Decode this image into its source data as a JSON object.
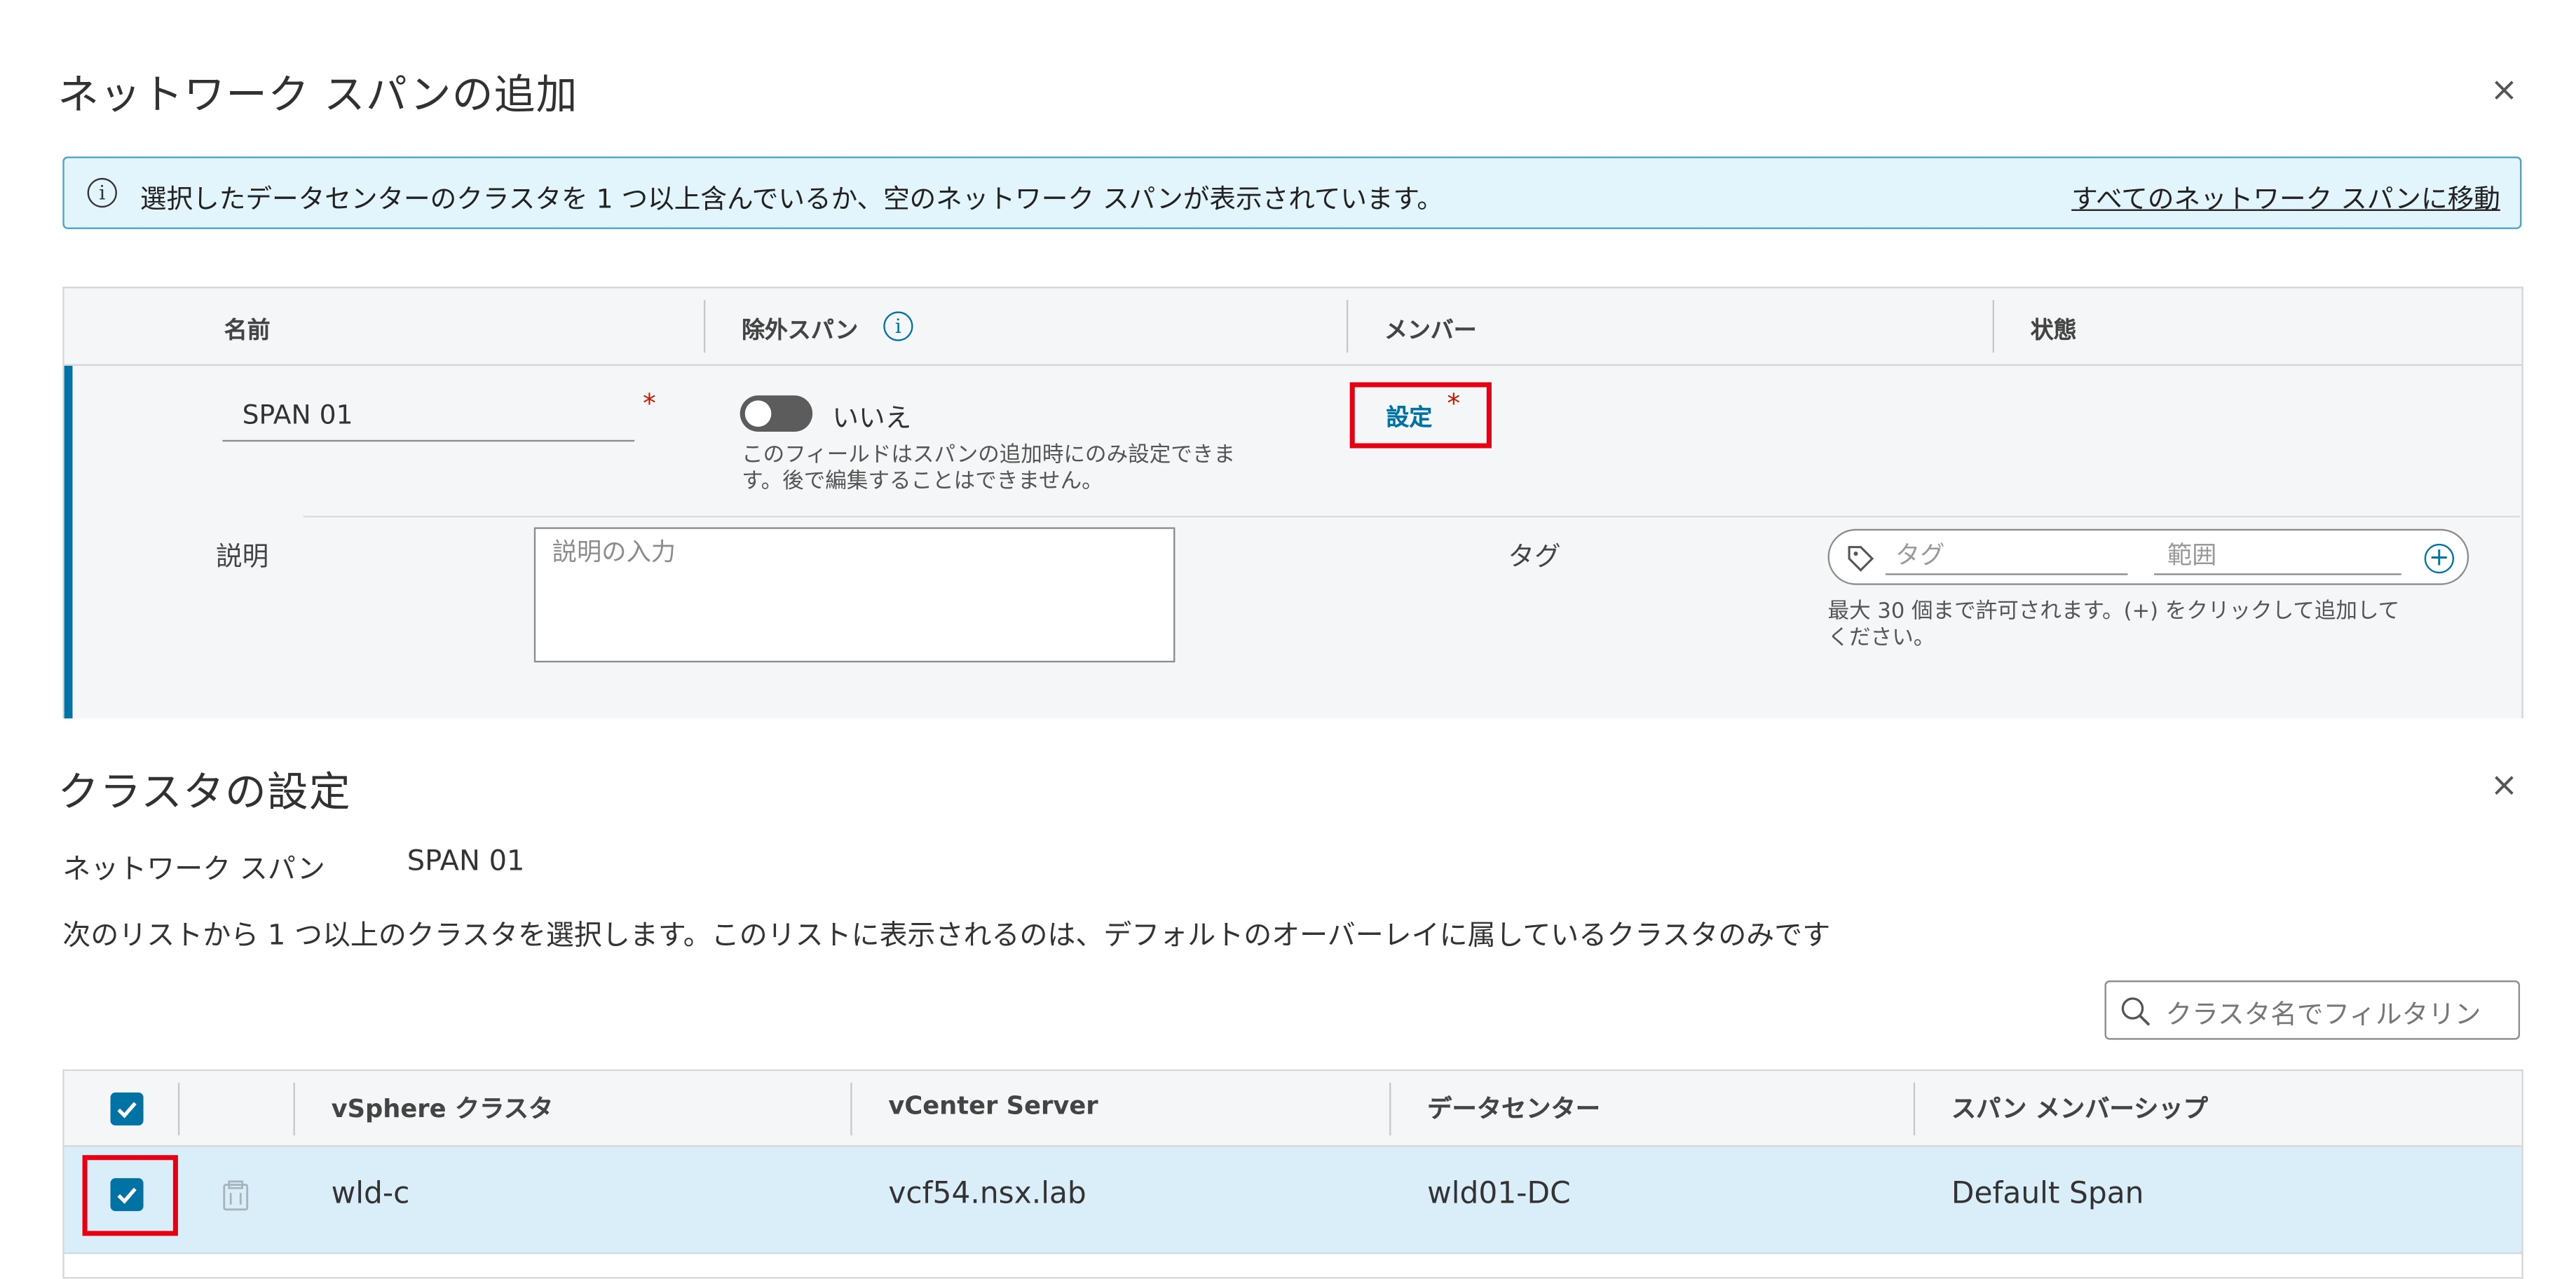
{
  "dialog": {
    "title": "ネットワーク スパンの追加",
    "close": "×"
  },
  "banner": {
    "icon": "info-icon",
    "text": "選択したデータセンターのクラスタを 1 つ以上含んでいるか、空のネットワーク スパンが表示されています。",
    "link": "すべてのネットワーク スパンに移動"
  },
  "span_grid": {
    "headers": {
      "name": "名前",
      "excluded": "除外スパン",
      "members": "メンバー",
      "status": "状態"
    },
    "row": {
      "name_value": "SPAN 01",
      "required": "*",
      "toggle_label": "いいえ",
      "toggle_on": false,
      "help": [
        "このフィールドはスパンの追加時にのみ設定できま",
        "す。後で編集することはできません。"
      ],
      "members_link": "設定",
      "description_label": "説明",
      "description_placeholder": "説明の入力",
      "tag_label": "タグ",
      "tag_placeholder": "タグ",
      "scope_placeholder": "範囲",
      "tag_help": [
        "最大 30 個まで許可されます。(+) をクリックして追加して",
        "ください。"
      ]
    }
  },
  "cluster_dialog": {
    "title": "クラスタの設定",
    "close": "×",
    "span_label": "ネットワーク スパン",
    "span_value": "SPAN 01",
    "instruction": "次のリストから 1 つ以上のクラスタを選択します。このリストに表示されるのは、デフォルトのオーバーレイに属しているクラスタのみです",
    "filter_placeholder": "クラスタ名でフィルタリン",
    "table": {
      "headers": [
        "vSphere クラスタ",
        "vCenter Server",
        "データセンター",
        "スパン メンバーシップ"
      ],
      "rows": [
        {
          "cluster": "wld-c",
          "vcenter": "vcf54.nsx.lab",
          "datacenter": "wld01-DC",
          "membership": "Default Span",
          "selected": true
        }
      ]
    }
  },
  "colors": {
    "accent": "#0072a3",
    "highlight": "#e60012",
    "banner_bg": "#e3f5fc",
    "row_selected": "#d9eef9"
  }
}
